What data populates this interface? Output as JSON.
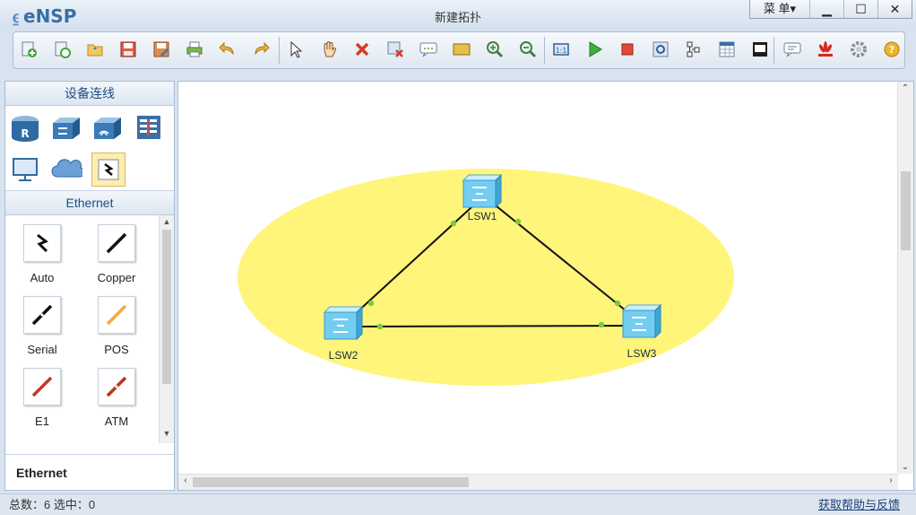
{
  "app": {
    "logo": "eNSP",
    "window_title": "新建拓扑",
    "menu_label": "菜 单▾"
  },
  "toolbar": {
    "buttons": [
      "new-topology",
      "new-example",
      "open",
      "save",
      "save-as",
      "print",
      "undo",
      "redo",
      "select",
      "pan",
      "delete",
      "delete-connection",
      "add-note",
      "add-area",
      "zoom-in",
      "zoom-out",
      "fit",
      "start-device",
      "stop-device",
      "capture",
      "topology-manage",
      "show-grid",
      "terminal",
      "chat",
      "huawei",
      "settings",
      "help"
    ]
  },
  "left_panel": {
    "header": "设备连线",
    "devices": [
      "router",
      "switch",
      "wireless",
      "firewall",
      "pc",
      "cloud",
      "connection"
    ],
    "category_header": "Ethernet",
    "cables": [
      {
        "label": "Auto",
        "color": "#111111"
      },
      {
        "label": "Copper",
        "color": "#111111"
      },
      {
        "label": "Serial",
        "color": "#111111"
      },
      {
        "label": "POS",
        "color": "#f5a742"
      },
      {
        "label": "E1",
        "color": "#c0392b"
      },
      {
        "label": "ATM",
        "color": "#b03a1e"
      }
    ],
    "footer_label": "Ethernet"
  },
  "canvas": {
    "area_color": "#fff57a",
    "nodes": [
      {
        "id": "LSW1"
      },
      {
        "id": "LSW2"
      },
      {
        "id": "LSW3"
      }
    ],
    "links": [
      [
        "LSW1",
        "LSW2"
      ],
      [
        "LSW1",
        "LSW3"
      ],
      [
        "LSW2",
        "LSW3"
      ]
    ],
    "port_color": "#7ccb3c"
  },
  "status": {
    "left": "总数：6 选中：0",
    "right": "获取帮助与反馈"
  }
}
